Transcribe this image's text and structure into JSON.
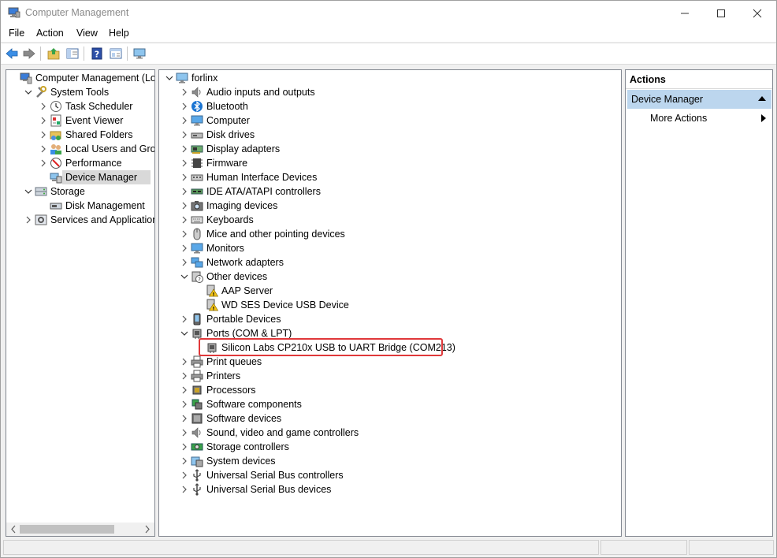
{
  "window": {
    "title": "Computer Management"
  },
  "menu": [
    "File",
    "Action",
    "View",
    "Help"
  ],
  "toolbar": {
    "buttons": [
      "back-icon",
      "forward-icon",
      "up-folder-icon",
      "show-hide-tree-icon",
      "help-icon",
      "properties-icon",
      "monitor-icon"
    ]
  },
  "left_tree": [
    {
      "label": "Computer Management (Local",
      "icon": "computer-management-icon",
      "level": 0,
      "expander": "none"
    },
    {
      "label": "System Tools",
      "icon": "tools-icon",
      "level": 1,
      "expander": "expanded"
    },
    {
      "label": "Task Scheduler",
      "icon": "clock-icon",
      "level": 2,
      "expander": "collapsed"
    },
    {
      "label": "Event Viewer",
      "icon": "event-viewer-icon",
      "level": 2,
      "expander": "collapsed"
    },
    {
      "label": "Shared Folders",
      "icon": "shared-folder-icon",
      "level": 2,
      "expander": "collapsed"
    },
    {
      "label": "Local Users and Groups",
      "icon": "users-icon",
      "level": 2,
      "expander": "collapsed"
    },
    {
      "label": "Performance",
      "icon": "performance-icon",
      "level": 2,
      "expander": "collapsed"
    },
    {
      "label": "Device Manager",
      "icon": "device-manager-icon",
      "level": 2,
      "expander": "none",
      "selected": true
    },
    {
      "label": "Storage",
      "icon": "storage-icon",
      "level": 1,
      "expander": "expanded"
    },
    {
      "label": "Disk Management",
      "icon": "disk-management-icon",
      "level": 2,
      "expander": "none"
    },
    {
      "label": "Services and Applications",
      "icon": "services-icon",
      "level": 1,
      "expander": "collapsed"
    }
  ],
  "device_tree": [
    {
      "label": "forlinx",
      "icon": "computer-icon",
      "level": 0,
      "expander": "expanded"
    },
    {
      "label": "Audio inputs and outputs",
      "icon": "speaker-icon",
      "level": 1,
      "expander": "collapsed"
    },
    {
      "label": "Bluetooth",
      "icon": "bluetooth-icon",
      "level": 1,
      "expander": "collapsed"
    },
    {
      "label": "Computer",
      "icon": "monitor-icon",
      "level": 1,
      "expander": "collapsed"
    },
    {
      "label": "Disk drives",
      "icon": "disk-drive-icon",
      "level": 1,
      "expander": "collapsed"
    },
    {
      "label": "Display adapters",
      "icon": "display-adapter-icon",
      "level": 1,
      "expander": "collapsed"
    },
    {
      "label": "Firmware",
      "icon": "firmware-icon",
      "level": 1,
      "expander": "collapsed"
    },
    {
      "label": "Human Interface Devices",
      "icon": "hid-icon",
      "level": 1,
      "expander": "collapsed"
    },
    {
      "label": "IDE ATA/ATAPI controllers",
      "icon": "ide-controller-icon",
      "level": 1,
      "expander": "collapsed"
    },
    {
      "label": "Imaging devices",
      "icon": "camera-icon",
      "level": 1,
      "expander": "collapsed"
    },
    {
      "label": "Keyboards",
      "icon": "keyboard-icon",
      "level": 1,
      "expander": "collapsed"
    },
    {
      "label": "Mice and other pointing devices",
      "icon": "mouse-icon",
      "level": 1,
      "expander": "collapsed"
    },
    {
      "label": "Monitors",
      "icon": "monitor-icon",
      "level": 1,
      "expander": "collapsed"
    },
    {
      "label": "Network adapters",
      "icon": "network-adapter-icon",
      "level": 1,
      "expander": "collapsed"
    },
    {
      "label": "Other devices",
      "icon": "unknown-device-icon",
      "level": 1,
      "expander": "expanded"
    },
    {
      "label": "AAP Server",
      "icon": "warning-device-icon",
      "level": 2,
      "expander": "none"
    },
    {
      "label": "WD SES Device USB Device",
      "icon": "warning-device-icon",
      "level": 2,
      "expander": "none"
    },
    {
      "label": "Portable Devices",
      "icon": "portable-device-icon",
      "level": 1,
      "expander": "collapsed"
    },
    {
      "label": "Ports (COM & LPT)",
      "icon": "port-icon",
      "level": 1,
      "expander": "expanded"
    },
    {
      "label": "Silicon Labs CP210x USB to UART Bridge (COM213)",
      "icon": "port-icon",
      "level": 2,
      "expander": "none",
      "highlighted": true
    },
    {
      "label": "Print queues",
      "icon": "printer-icon",
      "level": 1,
      "expander": "collapsed"
    },
    {
      "label": "Printers",
      "icon": "printer-icon",
      "level": 1,
      "expander": "collapsed"
    },
    {
      "label": "Processors",
      "icon": "processor-icon",
      "level": 1,
      "expander": "collapsed"
    },
    {
      "label": "Software components",
      "icon": "software-component-icon",
      "level": 1,
      "expander": "collapsed"
    },
    {
      "label": "Software devices",
      "icon": "software-device-icon",
      "level": 1,
      "expander": "collapsed"
    },
    {
      "label": "Sound, video and game controllers",
      "icon": "speaker-icon",
      "level": 1,
      "expander": "collapsed"
    },
    {
      "label": "Storage controllers",
      "icon": "storage-controller-icon",
      "level": 1,
      "expander": "collapsed"
    },
    {
      "label": "System devices",
      "icon": "system-device-icon",
      "level": 1,
      "expander": "collapsed"
    },
    {
      "label": "Universal Serial Bus controllers",
      "icon": "usb-icon",
      "level": 1,
      "expander": "collapsed"
    },
    {
      "label": "Universal Serial Bus devices",
      "icon": "usb-icon",
      "level": 1,
      "expander": "collapsed"
    }
  ],
  "actions": {
    "header": "Actions",
    "section": "Device Manager",
    "more": "More Actions"
  },
  "colors": {
    "highlight_box": "#e0383a",
    "action_section_bg": "#bcd6ee",
    "selected_bg": "#d9d9d9"
  }
}
